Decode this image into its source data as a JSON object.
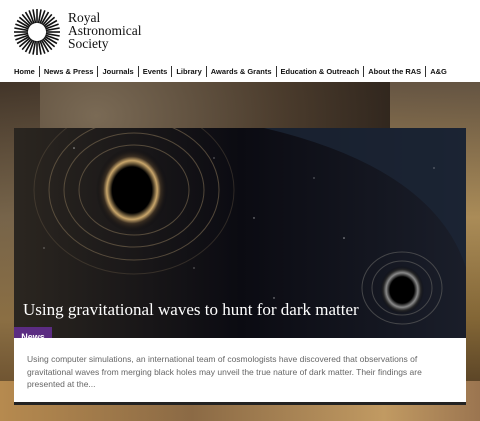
{
  "logo": {
    "line1": "Royal",
    "line2": "Astronomical",
    "line3": "Society",
    "icon": "sun-rays-icon"
  },
  "nav": {
    "items": [
      {
        "label": "Home"
      },
      {
        "label": "News & Press"
      },
      {
        "label": "Journals"
      },
      {
        "label": "Events"
      },
      {
        "label": "Library"
      },
      {
        "label": "Awards & Grants"
      },
      {
        "label": "Education & Outreach"
      },
      {
        "label": "About the RAS"
      },
      {
        "label": "A&G"
      }
    ]
  },
  "feature": {
    "headline": "Using gravitational waves to hunt for dark matter",
    "badge": "News",
    "summary": "Using computer simulations, an international team of cosmologists have discovered that observations of gravitational waves from merging black holes may unveil the true nature of dark matter. Their findings are presented at the..."
  },
  "colors": {
    "badge": "#5b2c82",
    "card_image_bg": "#07070c"
  }
}
